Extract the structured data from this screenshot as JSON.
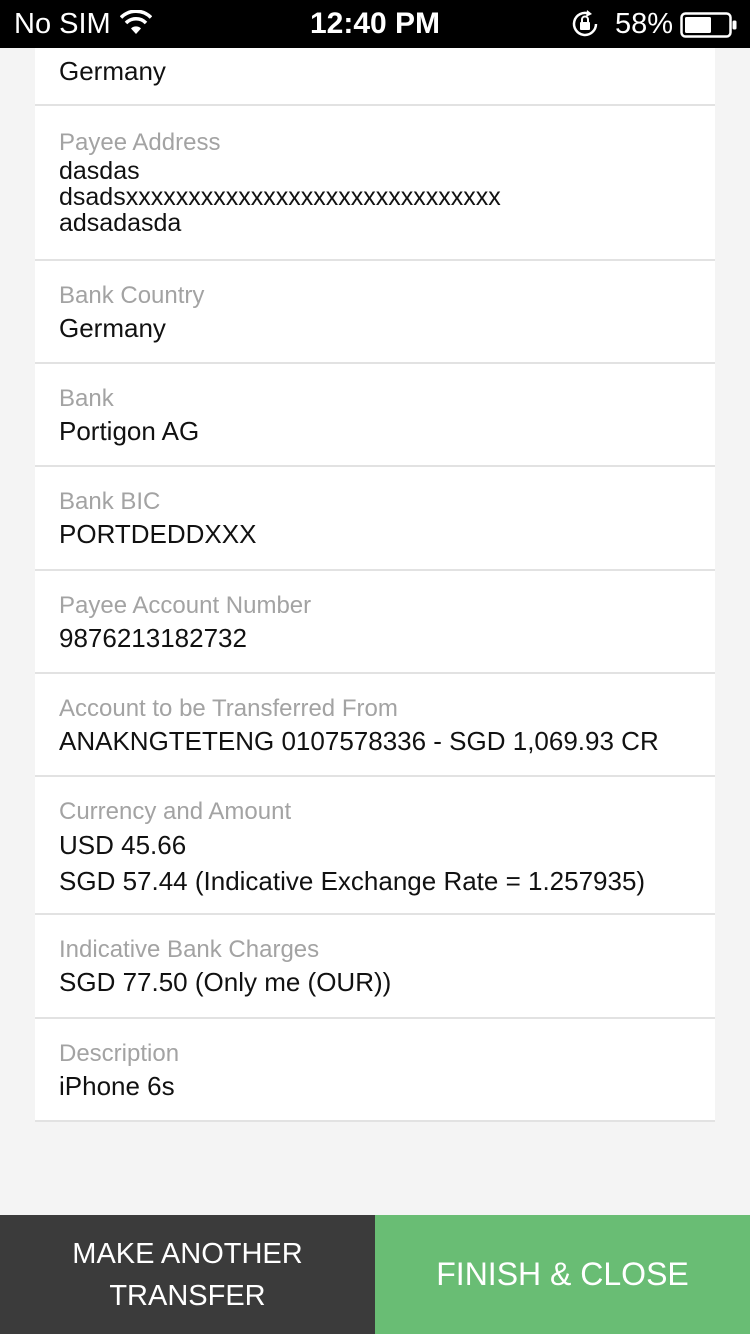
{
  "status_bar": {
    "carrier": "No SIM",
    "time": "12:40 PM",
    "battery": "58%"
  },
  "details": [
    {
      "label": "",
      "value": "Germany"
    },
    {
      "label": "Payee Address",
      "lines": [
        "dasdas",
        "dsadsxxxxxxxxxxxxxxxxxxxxxxxxxxxxxx",
        "adsadasda"
      ]
    },
    {
      "label": "Bank Country",
      "value": "Germany"
    },
    {
      "label": "Bank",
      "value": "Portigon AG"
    },
    {
      "label": "Bank BIC",
      "value": "PORTDEDDXXX"
    },
    {
      "label": "Payee Account Number",
      "value": "9876213182732"
    },
    {
      "label": "Account to be Transferred From",
      "value": "ANAKNGTETENG 0107578336 - SGD 1,069.93 CR"
    },
    {
      "label": "Currency and Amount",
      "lines": [
        "USD 45.66",
        "SGD 57.44 (Indicative Exchange Rate = 1.257935)"
      ]
    },
    {
      "label": "Indicative Bank Charges",
      "value": "SGD 77.50 (Only me (OUR))"
    },
    {
      "label": "Description",
      "value": "iPhone 6s"
    }
  ],
  "actions": {
    "make_another_line1": "MAKE ANOTHER",
    "make_another_line2": "TRANSFER",
    "finish": "FINISH & CLOSE"
  }
}
